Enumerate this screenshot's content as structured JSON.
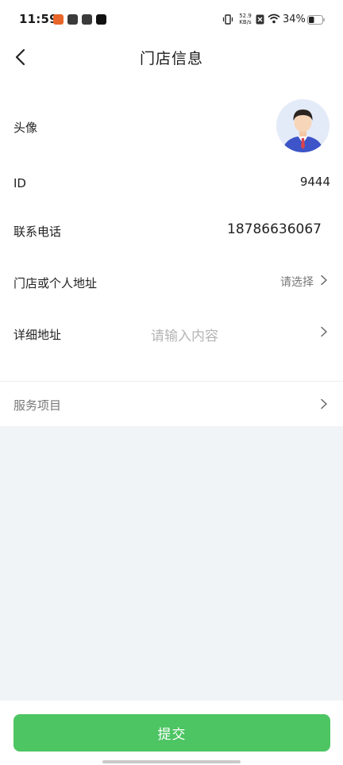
{
  "status_bar": {
    "time": "11:59",
    "net_speed_value": "52.9",
    "net_speed_unit": "KB/s",
    "battery": "34%"
  },
  "header": {
    "title": "门店信息"
  },
  "form": {
    "avatar_label": "头像",
    "id_label": "ID",
    "id_value": "9444",
    "phone_label": "联系电话",
    "phone_value": "18786636067",
    "address_label": "门店或个人地址",
    "address_hint": "请选择",
    "detail_label": "详细地址",
    "detail_placeholder": "请输入内容",
    "service_label": "服务项目"
  },
  "footer": {
    "submit_label": "提交"
  },
  "colors": {
    "accent": "#4cc562",
    "page_bg": "#f1f4f7"
  }
}
